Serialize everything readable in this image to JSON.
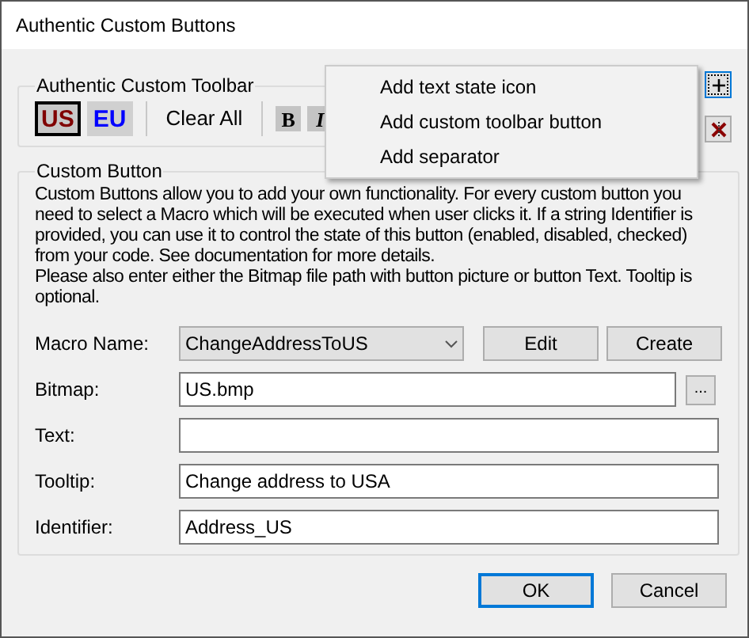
{
  "window": {
    "title": "Authentic Custom Buttons"
  },
  "toolbar_group": {
    "title": "Authentic Custom Toolbar",
    "items": [
      {
        "kind": "state",
        "label": "US",
        "color": "#800000",
        "selected": true
      },
      {
        "kind": "state",
        "label": "EU",
        "color": "#0000ff",
        "selected": false
      },
      {
        "kind": "separator"
      },
      {
        "kind": "text",
        "label": "Clear All"
      },
      {
        "kind": "separator"
      },
      {
        "kind": "bold",
        "label": "B"
      },
      {
        "kind": "italic",
        "label": "I"
      }
    ]
  },
  "side_buttons": [
    {
      "kind": "add",
      "focused": true
    },
    {
      "kind": "delete",
      "focused": false
    }
  ],
  "menu": {
    "items": [
      "Add text state icon",
      "Add custom toolbar button",
      "Add separator"
    ]
  },
  "custom_button_group": {
    "title": "Custom Button",
    "description": "Custom Buttons allow you to add your own functionality. For every custom button you need to select a Macro which will be executed when user clicks it. If a string Identifier is provided, you can use it to control the state of this button (enabled, disabled, checked) from your code. See documentation for more details.",
    "note": "Please also enter either the Bitmap file path with button picture or button Text. Tooltip is optional.",
    "macro": {
      "label": "Macro Name:",
      "value": "ChangeAddressToUS",
      "buttons": [
        "Edit",
        "Create"
      ]
    },
    "fields": [
      {
        "label": "Bitmap:",
        "value": "US.bmp",
        "browse": "..."
      },
      {
        "label": "Text:"
      },
      {
        "label": "Tooltip:",
        "value": "Change address to USA"
      },
      {
        "label": "Identifier:",
        "value": "Address_US"
      }
    ]
  },
  "buttons": [
    {
      "label": "OK",
      "default": true
    },
    {
      "label": "Cancel",
      "default": false
    }
  ]
}
